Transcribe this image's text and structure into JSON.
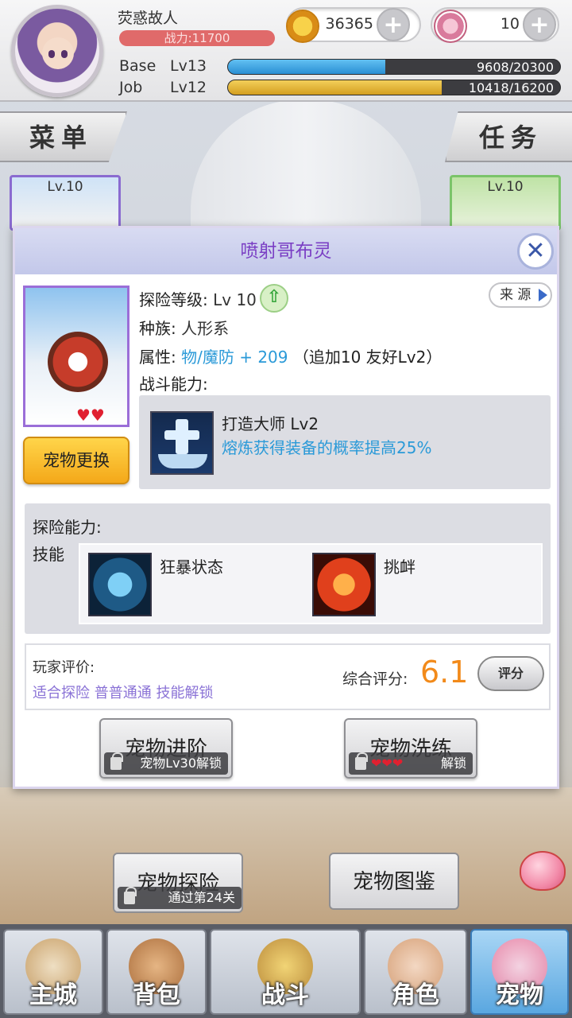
{
  "player": {
    "name": "荧惑故人",
    "power": "战力:11700",
    "gold": "36365",
    "gems": "10",
    "base_label": "Base",
    "base_level": "Lv13",
    "base_exp": "9608/20300",
    "base_progress": 0.473,
    "job_label": "Job",
    "job_level": "Lv12",
    "job_exp": "10418/16200",
    "job_progress": 0.643
  },
  "side": {
    "menu": "菜单",
    "quest": "任务",
    "left_card_level": "Lv.10",
    "right_card_level": "Lv.10"
  },
  "dialog": {
    "title": "喷射哥布灵",
    "level_label": "探险等级:",
    "level_value": "Lv 10",
    "source": "来 源",
    "race_label": "种族:",
    "race_value": "人形系",
    "attr_label": "属性:",
    "attr_value": "物/魔防 + 209",
    "attr_bonus": "（追加10 友好Lv2）",
    "battle_label": "战斗能力:",
    "battle_skill_name": "打造大师 Lv2",
    "battle_skill_desc": "熔炼获得装备的概率提高25%",
    "change_pet": "宠物更换",
    "hearts": "♥♥",
    "explore_label": "探险能力:",
    "skills_label": "技能",
    "skill1": "狂暴状态",
    "skill2": "挑衅",
    "rating_label": "玩家评价:",
    "rating_tags": "适合探险 普普通通 技能解锁",
    "overall_label": "综合评分:",
    "overall_score": "6.1",
    "score_btn": "评分",
    "advance_btn": "宠物进阶",
    "advance_lock": "宠物Lv30解锁",
    "refine_btn": "宠物洗练",
    "refine_hearts": "❤❤❤",
    "refine_lock": "解锁"
  },
  "lower": {
    "explore_btn": "宠物探险",
    "explore_lock": "通过第24关",
    "handbook_btn": "宠物图鉴"
  },
  "nav": {
    "city": "主城",
    "bag": "背包",
    "battle": "战斗",
    "role": "角色",
    "pet": "宠物"
  },
  "colors": {
    "title_purple": "#7a3ec4",
    "skill_desc_blue": "#2b9ad8",
    "score_orange": "#f28a1a",
    "base_bar": "#3aa4e6",
    "job_bar": "#e8b73a"
  }
}
